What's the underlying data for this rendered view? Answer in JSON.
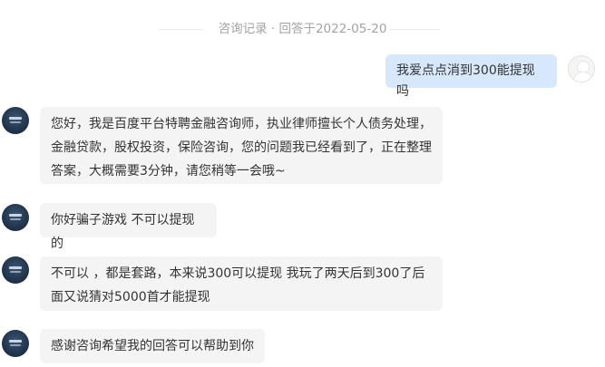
{
  "header": {
    "title": "咨询记录 · 回答于2022-05-20"
  },
  "messages": [
    {
      "role": "user",
      "lines": [
        "我爱点点消到300能提现吗"
      ]
    },
    {
      "role": "agent",
      "lines": [
        "您好，我是百度平台特聘金融咨询师，执业律师擅长个人债务处理，",
        "金融贷款，股权投资，保险咨询，您的问题我已经看到了，正在整理",
        "答案，大概需要3分钟，请您稍等一会哦~"
      ]
    },
    {
      "role": "user",
      "lines": [
        "你好骗子游戏 不可以提现的"
      ]
    },
    {
      "role": "user",
      "lines": [
        "不可以 ，都是套路，本来说300可以提现 我玩了两天后到300了后",
        "面又说猜对5000首才能提现"
      ]
    },
    {
      "role": "agent",
      "lines": [
        "感谢咨询希望我的回答可以帮助到你"
      ]
    }
  ],
  "avatars": {
    "agent": "advisor-avatar-icon",
    "user": "user-avatar-icon"
  },
  "colors": {
    "user_bubble": "#d7e8fd",
    "agent_bubble": "#f4f4f4",
    "header_text": "#a3a3a3"
  }
}
